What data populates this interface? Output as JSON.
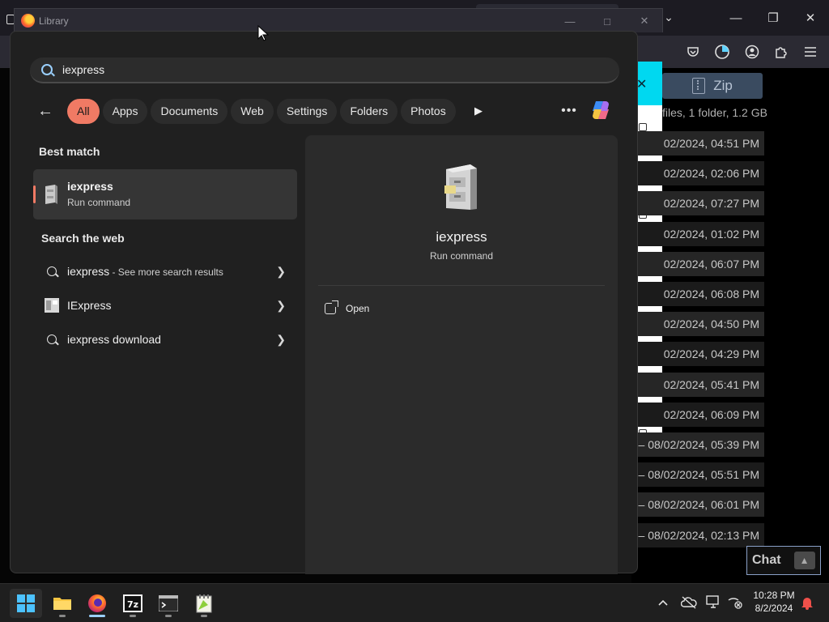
{
  "background": {
    "zip_label": "Zip",
    "files_summary": "files, 1 folder, 1.2 GB",
    "dates": [
      "02/2024, 04:51 PM",
      "02/2024, 02:06 PM",
      "02/2024, 07:27 PM",
      "02/2024, 01:02 PM",
      "02/2024, 06:07 PM",
      "02/2024, 06:08 PM",
      "02/2024, 04:50 PM",
      "02/2024, 04:29 PM",
      "02/2024, 05:41 PM",
      "02/2024, 06:09 PM",
      "– 08/02/2024, 05:39 PM",
      "– 08/02/2024, 05:51 PM",
      "– 08/02/2024, 06:01 PM",
      "– 08/02/2024, 02:13 PM"
    ],
    "chat_label": "Chat"
  },
  "library_window": {
    "title": "Library"
  },
  "search": {
    "query": "iexpress",
    "filters": [
      "All",
      "Apps",
      "Documents",
      "Web",
      "Settings",
      "Folders",
      "Photos"
    ],
    "active_filter": "All",
    "best_match_heading": "Best match",
    "best_match": {
      "title": "iexpress",
      "subtitle": "Run command"
    },
    "web_heading": "Search the web",
    "web_results": [
      {
        "main": "iexpress",
        "suffix": " - See more search results",
        "icon": "search-icon"
      },
      {
        "main": "IExpress",
        "suffix": "",
        "icon": "iexpress-app-icon"
      },
      {
        "main": "iexpress download",
        "suffix": "",
        "icon": "search-icon"
      }
    ],
    "detail": {
      "title": "iexpress",
      "subtitle": "Run command",
      "actions": [
        "Open"
      ]
    }
  },
  "taskbar": {
    "apps": [
      "start-button",
      "file-explorer",
      "firefox",
      "7zip",
      "terminal",
      "notepad-plus-plus"
    ],
    "clock_time": "10:28 PM",
    "clock_date": "8/2/2024"
  },
  "colors": {
    "accent": "#f07a64",
    "panel_bg": "#202020",
    "detail_bg": "#2b2b2b",
    "cyan": "#00d8f0"
  }
}
